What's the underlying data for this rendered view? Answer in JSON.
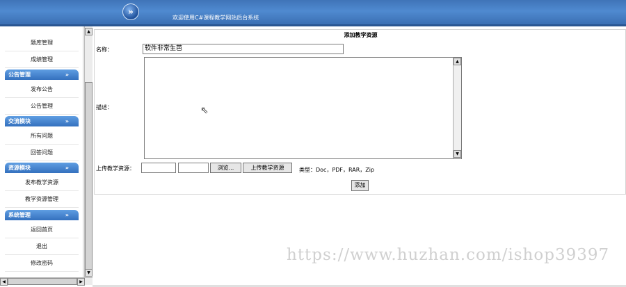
{
  "header": {
    "title": "欢迎使用C#课程教学网站后台系统",
    "arrow_icon": "double-chevron-right-icon"
  },
  "sidebar": {
    "items_top": [
      {
        "label": "题库管理"
      },
      {
        "label": "成绩管理"
      }
    ],
    "groups": [
      {
        "title": "公告管理",
        "items": [
          "发布公告",
          "公告管理"
        ]
      },
      {
        "title": "交流模块",
        "items": [
          "所有问题",
          "回答问题"
        ]
      },
      {
        "title": "资源模块",
        "items": [
          "发布教学资源",
          "教学资源管理"
        ]
      },
      {
        "title": "系统管理",
        "items": [
          "返回首页",
          "退出",
          "修改密码"
        ]
      }
    ],
    "chevron": "»"
  },
  "form": {
    "title": "添加教学资源",
    "name_label": "名称：",
    "name_value": "软件非常生芭",
    "desc_label": "描述：",
    "upload_label": "上传教学资源：",
    "browse_button": "浏览...",
    "upload_button": "上传教学资源",
    "types_text": "类型：Doc，PDF，RAR，Zip",
    "submit_button": "添加"
  },
  "watermark": "https://www.huzhan.com/ishop39397"
}
